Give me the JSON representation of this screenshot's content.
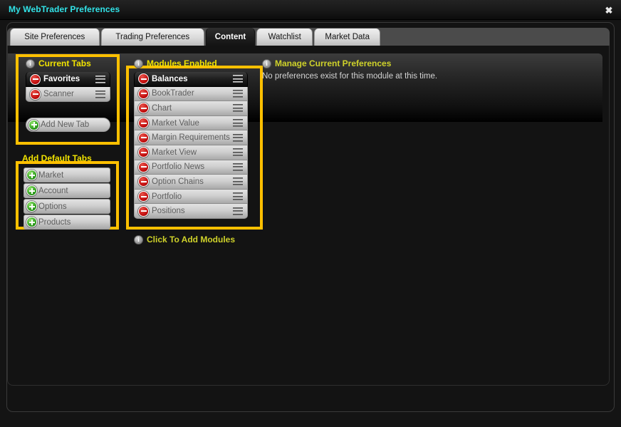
{
  "window": {
    "title": "My WebTrader Preferences",
    "close_label": "✖"
  },
  "tabs": [
    {
      "label": "Site Preferences",
      "active": false
    },
    {
      "label": "Trading Preferences",
      "active": false
    },
    {
      "label": "Content",
      "active": true
    },
    {
      "label": "Watchlist",
      "active": false
    },
    {
      "label": "Market Data",
      "active": false
    }
  ],
  "sections": {
    "current_tabs": {
      "title": "Current Tabs",
      "info_icon": "info-icon",
      "items": [
        {
          "label": "Favorites",
          "selected": true,
          "action_icon": "minus-icon",
          "handle_icon": "drag-handle-icon"
        },
        {
          "label": "Scanner",
          "selected": false,
          "action_icon": "minus-icon",
          "handle_icon": "drag-handle-icon"
        }
      ],
      "add_button": {
        "label": "Add New Tab",
        "icon": "plus-icon"
      }
    },
    "default_tabs": {
      "title": "Add Default Tabs",
      "items": [
        {
          "label": "Market",
          "icon": "plus-icon"
        },
        {
          "label": "Account",
          "icon": "plus-icon"
        },
        {
          "label": "Options",
          "icon": "plus-icon"
        },
        {
          "label": "Products",
          "icon": "plus-icon"
        }
      ]
    },
    "modules_enabled": {
      "title": "Modules Enabled",
      "info_icon": "info-icon",
      "footer": {
        "title": "Click To Add Modules",
        "info_icon": "info-icon"
      },
      "items": [
        {
          "label": "Balances",
          "selected": true,
          "action_icon": "minus-icon",
          "handle_icon": "drag-handle-icon"
        },
        {
          "label": "BookTrader",
          "selected": false,
          "action_icon": "minus-icon",
          "handle_icon": "drag-handle-icon"
        },
        {
          "label": "Chart",
          "selected": false,
          "action_icon": "minus-icon",
          "handle_icon": "drag-handle-icon"
        },
        {
          "label": "Market Value",
          "selected": false,
          "action_icon": "minus-icon",
          "handle_icon": "drag-handle-icon"
        },
        {
          "label": "Margin Requirements",
          "selected": false,
          "action_icon": "minus-icon",
          "handle_icon": "drag-handle-icon"
        },
        {
          "label": "Market View",
          "selected": false,
          "action_icon": "minus-icon",
          "handle_icon": "drag-handle-icon"
        },
        {
          "label": "Portfolio News",
          "selected": false,
          "action_icon": "minus-icon",
          "handle_icon": "drag-handle-icon"
        },
        {
          "label": "Option Chains",
          "selected": false,
          "action_icon": "minus-icon",
          "handle_icon": "drag-handle-icon"
        },
        {
          "label": "Portfolio",
          "selected": false,
          "action_icon": "minus-icon",
          "handle_icon": "drag-handle-icon"
        },
        {
          "label": "Positions",
          "selected": false,
          "action_icon": "minus-icon",
          "handle_icon": "drag-handle-icon"
        }
      ]
    },
    "manage_preferences": {
      "title": "Manage Current Preferences",
      "info_icon": "info-icon",
      "empty_message": "No preferences exist for this module at this time."
    }
  },
  "colors": {
    "title_accent": "#31e3e8",
    "section_heading": "#f2e400",
    "highlight_box": "#ffc000",
    "remove_button": "#c40f0f",
    "add_button": "#2f9e1e"
  }
}
